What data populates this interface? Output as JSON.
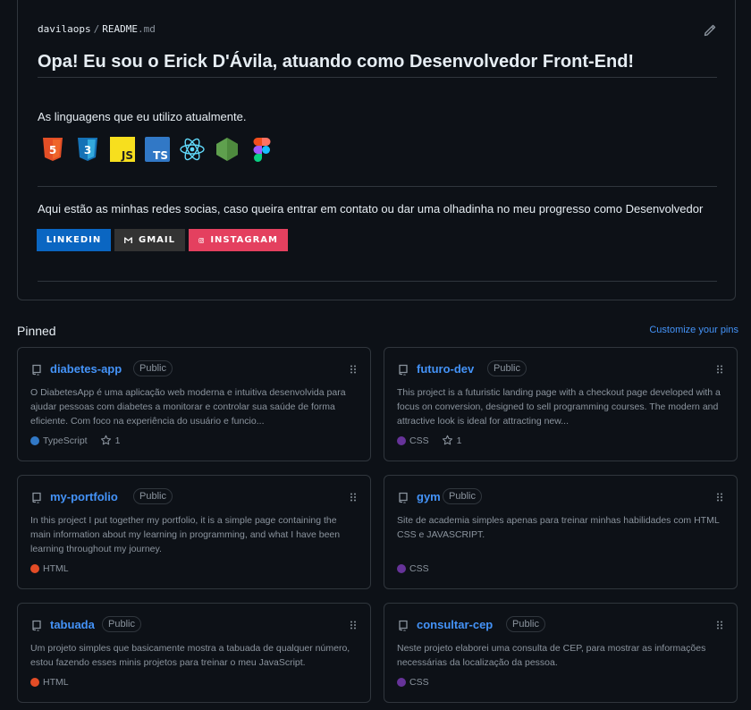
{
  "readme": {
    "owner": "davilaops",
    "separator": "/",
    "file_base": "README",
    "file_ext": ".md",
    "title": "Opa! Eu sou o Erick D'Ávila, atuando como Desenvolvedor Front-End!",
    "languages_text": "As linguagens que eu utilizo atualmente.",
    "languages": [
      {
        "icon": "html5-icon",
        "label": "5",
        "color": "#e34f26"
      },
      {
        "icon": "css3-icon",
        "label": "3",
        "color": "#1572b6"
      },
      {
        "icon": "javascript-icon",
        "label": "JS",
        "color": "#f7df1e"
      },
      {
        "icon": "typescript-icon",
        "label": "TS",
        "color": "#3178c6"
      },
      {
        "icon": "react-icon",
        "label": "",
        "color": "#61dafb"
      },
      {
        "icon": "nodejs-icon",
        "label": "",
        "color": "#5fa04e"
      },
      {
        "icon": "figma-icon",
        "label": "",
        "color": "#a259ff"
      }
    ],
    "social_text": "Aqui estão as minhas redes socias, caso queira entrar em contato ou dar uma olhadinha no meu progresso como Desenvolvedor",
    "badges": [
      {
        "label": "LINKEDIN",
        "color": "#0a66c2",
        "icon": ""
      },
      {
        "label": "GMAIL",
        "color": "#333333",
        "icon": "gmail-icon"
      },
      {
        "label": "INSTAGRAM",
        "color": "#e4405f",
        "icon": "instagram-icon"
      }
    ]
  },
  "pinned": {
    "heading": "Pinned",
    "customize_label": "Customize your pins",
    "repos": [
      {
        "name": "diabetes-app",
        "visibility": "Public",
        "description": "O DiabetesApp é uma aplicação web moderna e intuitiva desenvolvida para ajudar pessoas com diabetes a monitorar e controlar sua saúde de forma eficiente. Com foco na experiência do usuário e funcio...",
        "language": "TypeScript",
        "language_color": "#3178c6",
        "stars": "1"
      },
      {
        "name": "futuro-dev",
        "visibility": "Public",
        "description": "This project is a futuristic landing page with a checkout page developed with a focus on conversion, designed to sell programming courses. The modern and attractive look is ideal for attracting new...",
        "language": "CSS",
        "language_color": "#663399",
        "stars": "1"
      },
      {
        "name": "my-portfolio",
        "visibility": "Public",
        "description": "In this project I put together my portfolio, it is a simple page containing the main information about my learning in programming, and what I have been learning throughout my journey.",
        "language": "HTML",
        "language_color": "#e34c26",
        "stars": null
      },
      {
        "name": "gym",
        "visibility": "Public",
        "description": "Site de academia simples apenas para treinar minhas habilidades com HTML CSS e JAVASCRIPT.",
        "language": "CSS",
        "language_color": "#663399",
        "stars": null
      },
      {
        "name": "tabuada",
        "visibility": "Public",
        "description": "Um projeto simples que basicamente mostra a tabuada de qualquer número, estou fazendo esses minis projetos para treinar o meu JavaScript.",
        "language": "HTML",
        "language_color": "#e34c26",
        "stars": null
      },
      {
        "name": "consultar-cep",
        "visibility": "Public",
        "description": "Neste projeto elaborei uma consulta de CEP, para mostrar as informações necessárias da localização da pessoa.",
        "language": "CSS",
        "language_color": "#663399",
        "stars": null
      }
    ]
  }
}
